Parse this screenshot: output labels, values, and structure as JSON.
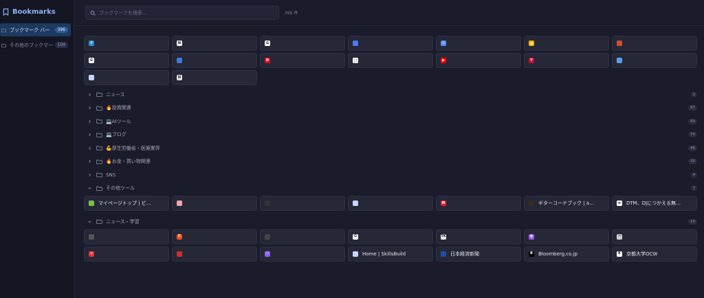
{
  "sidebar": {
    "title": "Bookmarks",
    "items": [
      {
        "label": "ブックマーク バー",
        "count": "396",
        "active": true
      },
      {
        "label": "その他のブックマーク",
        "count": "104",
        "active": false
      }
    ]
  },
  "search": {
    "placeholder": "ブックマークを検索...",
    "value": "",
    "total": "396 件"
  },
  "top_tiles": [
    {
      "title": "",
      "icon": "favicon-blue-square",
      "color": "#2a8fd6",
      "glyph": "f"
    },
    {
      "title": "",
      "icon": "notion-icon",
      "color": "#f0f0f0",
      "glyph": "N"
    },
    {
      "title": "",
      "icon": "google-icon",
      "color": "#ffffff",
      "glyph": "G"
    },
    {
      "title": "",
      "icon": "favicon-multicolor-icon",
      "color": "#4a78f0",
      "glyph": ""
    },
    {
      "title": "",
      "icon": "gemini-icon",
      "color": "#5b8cff",
      "glyph": "✦"
    },
    {
      "title": "",
      "icon": "google-drive-icon",
      "color": "#f4b400",
      "glyph": "▲"
    },
    {
      "title": "",
      "icon": "favicon-red-orange-icon",
      "color": "#d0502a",
      "glyph": ""
    },
    {
      "title": "",
      "icon": "google-icon",
      "color": "#ffffff",
      "glyph": "G"
    },
    {
      "title": "",
      "icon": "favicon-blue-page-icon",
      "color": "#3f7bd4",
      "glyph": ""
    },
    {
      "title": "",
      "icon": "netflix-icon",
      "color": "#e50914",
      "glyph": "N"
    },
    {
      "title": "",
      "icon": "scan-icon",
      "color": "#ffffff",
      "glyph": "◻"
    },
    {
      "title": "",
      "icon": "youtube-icon",
      "color": "#ff0000",
      "glyph": "▶"
    },
    {
      "title": "",
      "icon": "yahoo-icon",
      "color": "#c0102e",
      "glyph": "Y"
    },
    {
      "title": "",
      "icon": "favicon-blue-figure-icon",
      "color": "#5aa0e8",
      "glyph": ""
    },
    {
      "title": "",
      "icon": "globe-icon",
      "color": "#c8d6ff",
      "glyph": ""
    },
    {
      "title": "",
      "icon": "favicon-grid-icon",
      "color": "#e0e0e0",
      "glyph": "H"
    }
  ],
  "folders": [
    {
      "name": "ニュース",
      "count": "3",
      "expanded": false
    },
    {
      "name": "🔥投資関連",
      "count": "97",
      "expanded": false
    },
    {
      "name": "💻AIツール",
      "count": "99",
      "expanded": false
    },
    {
      "name": "💻ブログ",
      "count": "74",
      "expanded": false
    },
    {
      "name": "💪厚生労働省・医療業界",
      "count": "48",
      "expanded": false
    },
    {
      "name": "🔥お金・買い物関連",
      "count": "30",
      "expanded": false
    },
    {
      "name": "SNS",
      "count": "4",
      "expanded": false
    },
    {
      "name": "その他ツール",
      "count": "7",
      "expanded": true,
      "tiles": [
        {
          "title": "マイページトップ | ビ…",
          "icon": "favicon-green-icon",
          "color": "#7bc043",
          "glyph": ""
        },
        {
          "title": "",
          "icon": "favicon-pink-face-icon",
          "color": "#f1a3b0",
          "glyph": ""
        },
        {
          "title": "",
          "icon": "favicon-dark-logo-icon",
          "color": "#333333",
          "glyph": ""
        },
        {
          "title": "",
          "icon": "globe-icon",
          "color": "#c8d6ff",
          "glyph": ""
        },
        {
          "title": "",
          "icon": "favicon-red-badge-icon",
          "color": "#e0232b",
          "glyph": "M"
        },
        {
          "title": "ギターコードブック | a…",
          "icon": "guitar-icon",
          "color": "#3a2a20",
          "glyph": ""
        },
        {
          "title": "DTM、DJにつかえる無…",
          "icon": "favicon-n-icon",
          "color": "#ffffff",
          "glyph": "n"
        }
      ]
    },
    {
      "name": "ニュース・学習",
      "count": "14",
      "expanded": true,
      "tiles": [
        {
          "title": "",
          "icon": "favicon-dark-bird-icon",
          "color": "#555555",
          "glyph": ""
        },
        {
          "title": "",
          "icon": "favicon-orange-c-icon",
          "color": "#e8521f",
          "glyph": "C"
        },
        {
          "title": "",
          "icon": "favicon-dash-icon",
          "color": "#444444",
          "glyph": ""
        },
        {
          "title": "",
          "icon": "google-icon",
          "color": "#ffffff",
          "glyph": "G"
        },
        {
          "title": "",
          "icon": "favicon-tk-icon",
          "color": "#eeeeee",
          "glyph": "TK"
        },
        {
          "title": "",
          "icon": "podcast-icon",
          "color": "#9b5de5",
          "glyph": "◉"
        },
        {
          "title": "",
          "icon": "favicon-line-icon",
          "color": "#cccccc",
          "glyph": "¬"
        },
        {
          "title": "",
          "icon": "favicon-red-circle-icon",
          "color": "#e03030",
          "glyph": "◎"
        },
        {
          "title": "",
          "icon": "favicon-red-bar-icon",
          "color": "#c83030",
          "glyph": ""
        },
        {
          "title": "",
          "icon": "cube-icon",
          "color": "#8b5cf6",
          "glyph": "⬡"
        },
        {
          "title": "Home | SkillsBuild",
          "icon": "globe-icon",
          "color": "#c8d6ff",
          "glyph": ""
        },
        {
          "title": "日本経済新聞",
          "icon": "favicon-nikkei-icon",
          "color": "#1f4fa3",
          "glyph": ""
        },
        {
          "title": "Bloomberg.co.jp",
          "icon": "bloomberg-icon",
          "color": "#000000",
          "glyph": "B"
        },
        {
          "title": "京都大学OCW",
          "icon": "favicon-kyoto-icon",
          "color": "#ffffff",
          "glyph": "K"
        }
      ]
    }
  ]
}
